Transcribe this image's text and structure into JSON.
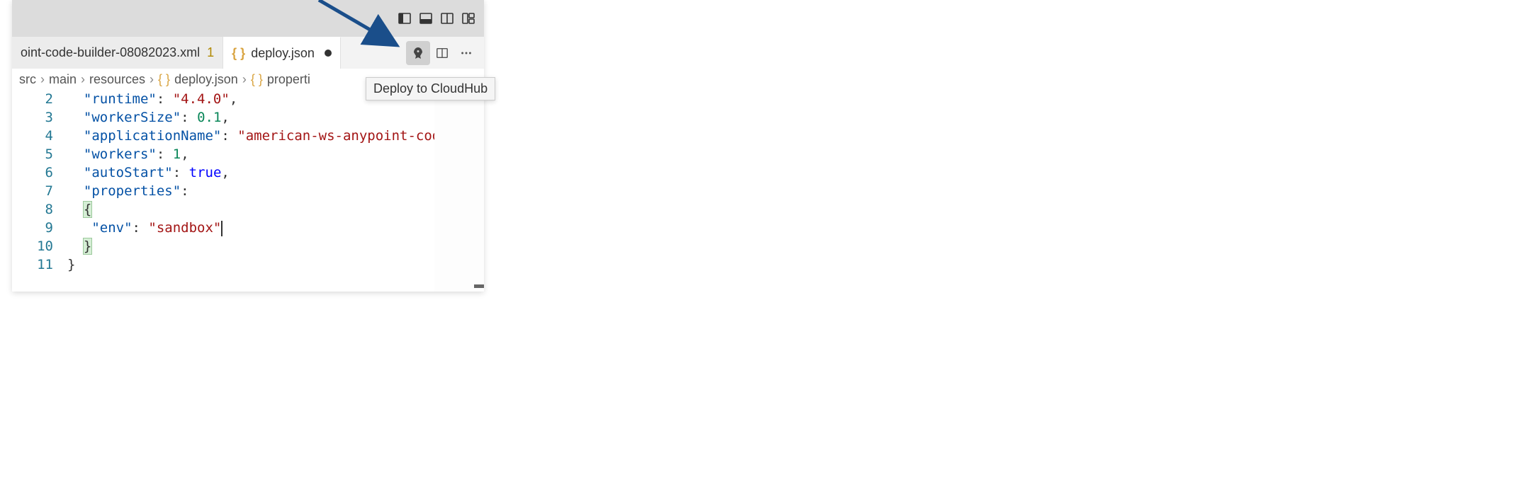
{
  "titlebar": {
    "icons": [
      "panel-left",
      "panel-bottom",
      "split-horizontal",
      "layout-grid"
    ]
  },
  "tabs": [
    {
      "label": "oint-code-builder-08082023.xml",
      "badge": "1",
      "active": false,
      "modified": false
    },
    {
      "label": "deploy.json",
      "badge": "",
      "active": true,
      "modified": true
    }
  ],
  "editor_actions": {
    "deploy": "Deploy",
    "split": "Split",
    "more": "More"
  },
  "tooltip": "Deploy to CloudHub",
  "breadcrumb": {
    "seg1": "src",
    "seg2": "main",
    "seg3": "resources",
    "seg4": "deploy.json",
    "seg5": "properti"
  },
  "code": {
    "line2": {
      "key": "\"runtime\"",
      "val": "\"4.4.0\"",
      "trail": ","
    },
    "line3": {
      "key": "\"workerSize\"",
      "val": "0.1",
      "trail": ","
    },
    "line4": {
      "key": "\"applicationName\"",
      "val": "\"american-ws-anypoint-cod",
      "trail": ""
    },
    "line5": {
      "key": "\"workers\"",
      "val": "1",
      "trail": ","
    },
    "line6": {
      "key": "\"autoStart\"",
      "val": "true",
      "trail": ","
    },
    "line7": {
      "key": "\"properties\"",
      "trail": ":"
    },
    "line8": {
      "brace": "{"
    },
    "line9": {
      "key": "\"env\"",
      "val": "\"sandbox\"",
      "trail": ""
    },
    "line10": {
      "brace": "}"
    },
    "line11": {
      "brace": "}"
    }
  },
  "line_numbers": [
    "2",
    "3",
    "4",
    "5",
    "6",
    "7",
    "8",
    "9",
    "10",
    "11"
  ]
}
